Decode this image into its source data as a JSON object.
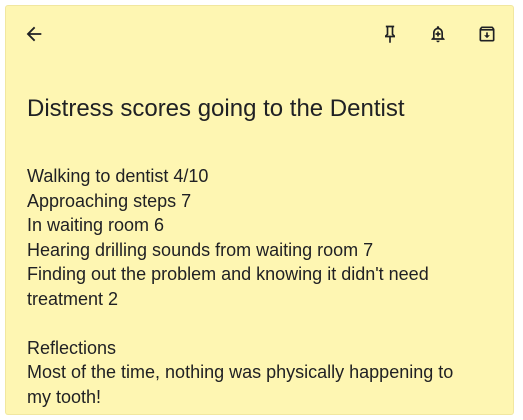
{
  "note": {
    "title": "Distress scores going to the Dentist",
    "lines": [
      "Walking to dentist 4/10",
      "Approaching steps 7",
      "In waiting room 6",
      "Hearing drilling sounds from waiting room 7",
      "Finding out the problem and knowing it didn't need",
      "treatment 2"
    ],
    "reflections": [
      "Reflections",
      "Most of the time, nothing was physically happening to",
      "my tooth!"
    ]
  },
  "icons": {
    "back": "arrow-left-icon",
    "pin": "pin-icon",
    "remind": "bell-plus-icon",
    "archive": "archive-icon"
  },
  "colors": {
    "note_background": "#fef6b2",
    "text": "#202124"
  }
}
